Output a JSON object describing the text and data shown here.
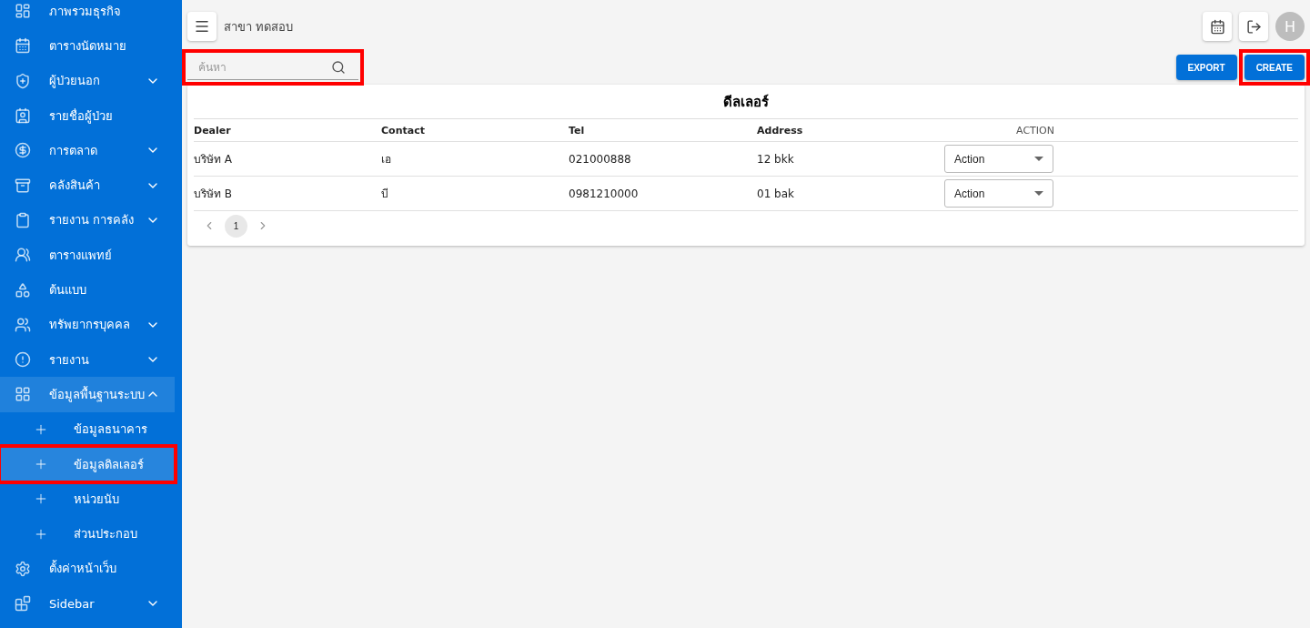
{
  "sidebar": {
    "items": [
      {
        "label": "ภาพรวมธุรกิจ"
      },
      {
        "label": "ตารางนัดหมาย"
      },
      {
        "label": "ผู้ป่วยนอก",
        "expanded": false
      },
      {
        "label": "รายชื่อผู้ป่วย"
      },
      {
        "label": "การตลาด",
        "expanded": false
      },
      {
        "label": "คลังสินค้า",
        "expanded": false
      },
      {
        "label": "รายงาน การคลัง",
        "expanded": false
      },
      {
        "label": "ตารางแพทย์"
      },
      {
        "label": "ต้นแบบ"
      },
      {
        "label": "ทรัพยากรบุคคล",
        "expanded": false
      },
      {
        "label": "รายงาน",
        "expanded": false
      },
      {
        "label": "ข้อมูลพื้นฐานระบบ",
        "expanded": true,
        "children": [
          {
            "label": "ข้อมูลธนาคาร",
            "selected": false,
            "highlighted": false
          },
          {
            "label": "ข้อมูลดิลเลอร์",
            "selected": true,
            "highlighted": true
          },
          {
            "label": "หน่วยนับ",
            "selected": false,
            "highlighted": false
          },
          {
            "label": "ส่วนประกอบ",
            "selected": false,
            "highlighted": false
          }
        ]
      },
      {
        "label": "ตั้งค่าหน้าเว็บ"
      },
      {
        "label": "Sidebar",
        "expanded": false
      }
    ]
  },
  "topbar": {
    "branch": "สาขา ทดสอบ",
    "avatar": "H"
  },
  "search": {
    "placeholder": "ค้นหา",
    "highlighted": true
  },
  "buttons": [
    {
      "label": "EXPORT",
      "highlighted": false
    },
    {
      "label": "CREATE",
      "highlighted": true
    }
  ],
  "table": {
    "title": "ดีลเลอร์",
    "columns": [
      "Dealer",
      "Contact",
      "Tel",
      "Address",
      "ACTION"
    ],
    "rows": [
      {
        "cells": [
          "บริษัท A",
          "เอ",
          "021000888",
          "12 bkk"
        ],
        "action": "Action"
      },
      {
        "cells": [
          "บริษัท B",
          "บี",
          "0981210000",
          "01 bak"
        ],
        "action": "Action"
      }
    ]
  },
  "pagination": {
    "pages": [
      {
        "label": "1",
        "selected": true
      }
    ]
  }
}
